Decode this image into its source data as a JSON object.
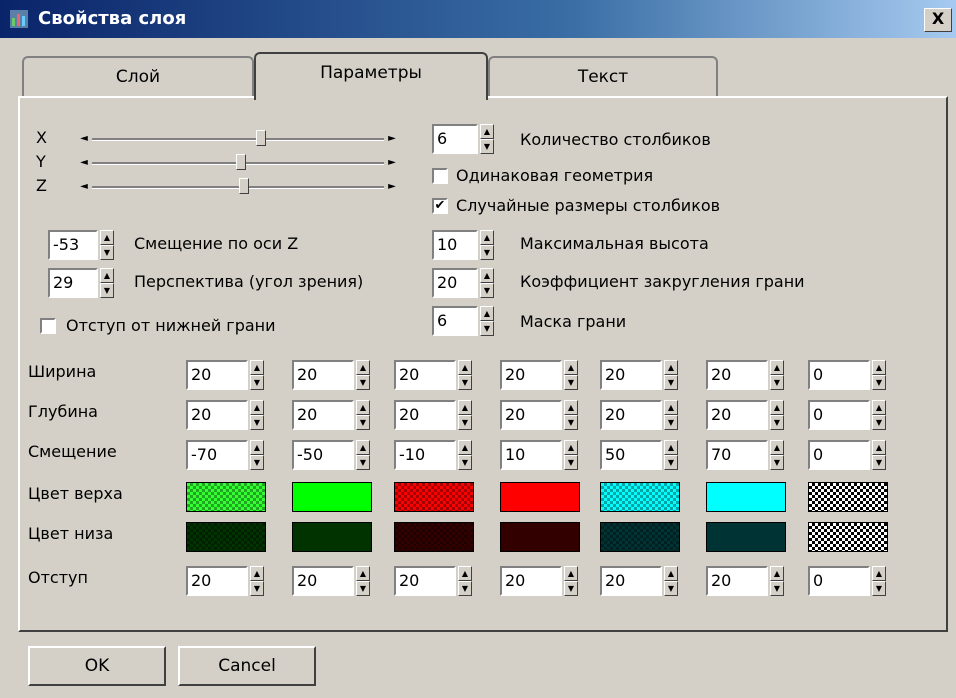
{
  "window": {
    "title": "Свойства слоя",
    "close_glyph": "X"
  },
  "tabs": [
    {
      "label": "Слой"
    },
    {
      "label": "Параметры"
    },
    {
      "label": "Текст"
    }
  ],
  "sliders": [
    {
      "label": "X",
      "value": 0.58
    },
    {
      "label": "Y",
      "value": 0.51
    },
    {
      "label": "Z",
      "value": 0.52
    }
  ],
  "left_spins": [
    {
      "value": "-53",
      "label": "Смещение по оси Z"
    },
    {
      "value": "29",
      "label": "Перспектива (угол зрения)"
    }
  ],
  "bottom_edge_offset": {
    "label": "Отступ от нижней грани",
    "checked": false
  },
  "columns_count": {
    "value": "6",
    "label": "Количество столбиков"
  },
  "same_geometry": {
    "label": "Одинаковая геометрия",
    "checked": false
  },
  "random_sizes": {
    "label": "Случайные размеры столбиков",
    "checked": true
  },
  "right_spins": [
    {
      "value": "10",
      "label": "Максимальная высота"
    },
    {
      "value": "20",
      "label": "Коэффициент закругления грани"
    },
    {
      "value": "6",
      "label": "Маска грани"
    }
  ],
  "grid": {
    "width": {
      "label": "Ширина",
      "values": [
        "20",
        "20",
        "20",
        "20",
        "20",
        "20",
        "0"
      ]
    },
    "depth": {
      "label": "Глубина",
      "values": [
        "20",
        "20",
        "20",
        "20",
        "20",
        "20",
        "0"
      ]
    },
    "offset": {
      "label": "Смещение",
      "values": [
        "-70",
        "-50",
        "-10",
        "10",
        "50",
        "70",
        "0"
      ]
    },
    "top_color": {
      "label": "Цвет верха",
      "colors": [
        "#33ff33",
        "#00ff00",
        "#ff0000",
        "#ff0000",
        "#00ffff",
        "#00ffff",
        "#ffffff"
      ],
      "dithered": [
        true,
        false,
        true,
        false,
        true,
        false,
        true
      ]
    },
    "bottom_color": {
      "label": "Цвет низа",
      "colors": [
        "#003300",
        "#003300",
        "#330000",
        "#330000",
        "#003333",
        "#003333",
        "#ffffff"
      ],
      "dithered": [
        true,
        false,
        true,
        false,
        true,
        false,
        true
      ]
    },
    "indent": {
      "label": "Отступ",
      "values": [
        "20",
        "20",
        "20",
        "20",
        "20",
        "20",
        "0"
      ]
    }
  },
  "buttons": {
    "ok": "OK",
    "cancel": "Cancel"
  }
}
